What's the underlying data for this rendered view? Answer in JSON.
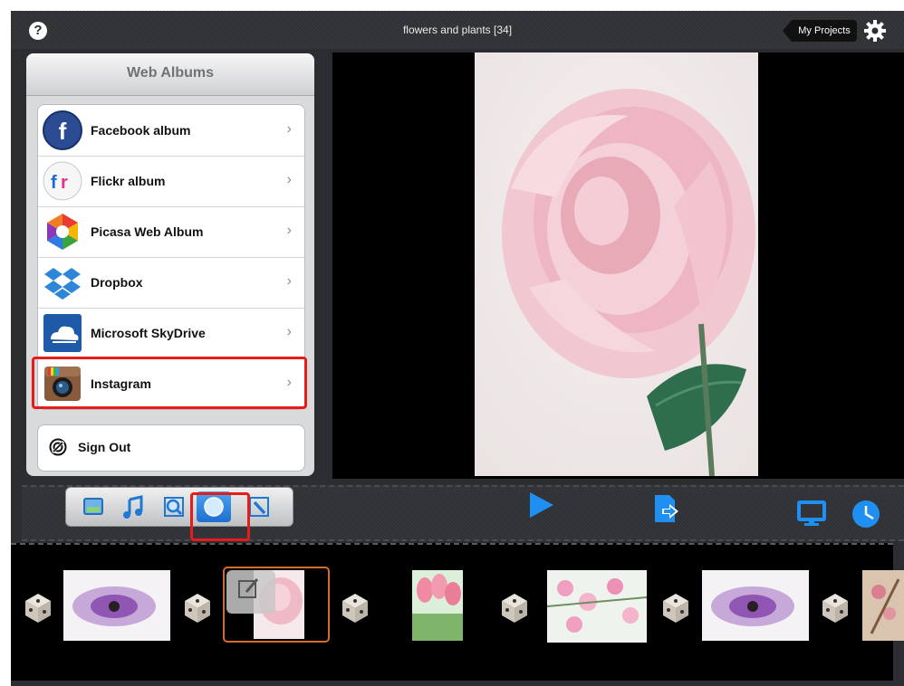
{
  "topbar": {
    "help_glyph": "?",
    "title": "flowers and plants  [34]",
    "my_projects_label": "My Projects"
  },
  "web_albums": {
    "title": "Web Albums",
    "items": [
      {
        "label": "Facebook album",
        "icon": "facebook-icon"
      },
      {
        "label": "Flickr album",
        "icon": "flickr-icon"
      },
      {
        "label": "Picasa Web Album",
        "icon": "picasa-icon"
      },
      {
        "label": "Dropbox",
        "icon": "dropbox-icon"
      },
      {
        "label": "Microsoft SkyDrive",
        "icon": "skydrive-icon"
      },
      {
        "label": "Instagram",
        "icon": "instagram-icon"
      }
    ],
    "chevron": "›",
    "sign_out_label": "Sign Out"
  },
  "toolbar": {
    "tools": [
      "photo-icon",
      "music-icon",
      "zoom-icon",
      "globe-icon",
      "edit-icon"
    ],
    "active_tool": "globe-icon"
  },
  "colors": {
    "accent": "#1f8ff2",
    "highlight": "#e41c1c"
  }
}
